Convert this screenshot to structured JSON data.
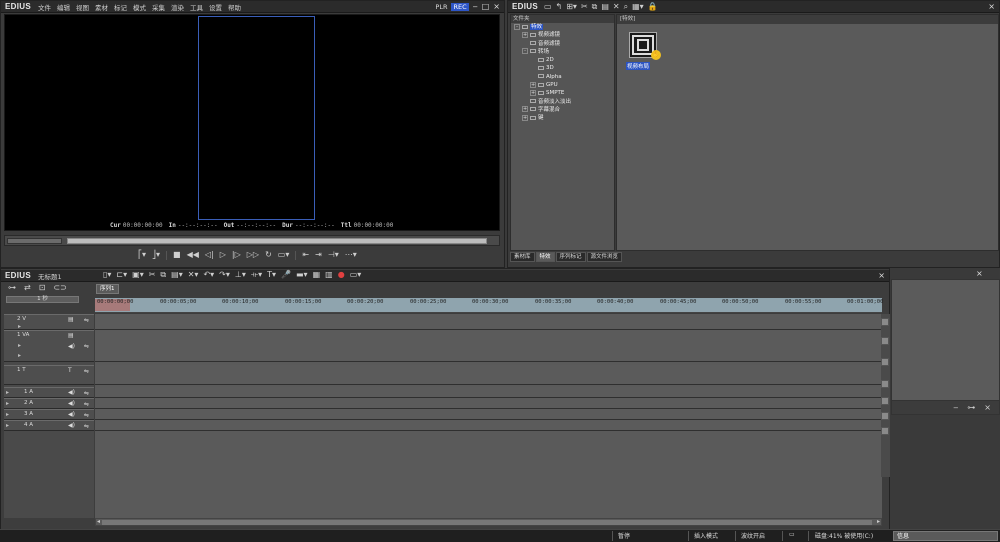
{
  "player": {
    "logo": "EDIUS",
    "menu": [
      "文件",
      "编辑",
      "视图",
      "素材",
      "标记",
      "模式",
      "采集",
      "渲染",
      "工具",
      "设置",
      "帮助"
    ],
    "plr_label": "PLR",
    "rec_label": "REC",
    "timecodes": [
      {
        "label": "Cur",
        "value": "00:00:00:00"
      },
      {
        "label": "In",
        "value": "--:--:--:--"
      },
      {
        "label": "Out",
        "value": "--:--:--:--"
      },
      {
        "label": "Dur",
        "value": "--:--:--:--"
      },
      {
        "label": "Ttl",
        "value": "00:00:00:00"
      }
    ]
  },
  "bin": {
    "logo": "EDIUS",
    "tree_header": "文件夹",
    "content_header": "[特效]",
    "tree": [
      {
        "label": "特效",
        "selected": true,
        "toggle": "-",
        "indent": 0
      },
      {
        "label": "视频滤镜",
        "toggle": "+",
        "indent": 1
      },
      {
        "label": "音频滤镜",
        "toggle": "",
        "indent": 1
      },
      {
        "label": "转场",
        "toggle": "-",
        "indent": 1
      },
      {
        "label": "2D",
        "toggle": "",
        "indent": 2
      },
      {
        "label": "3D",
        "toggle": "",
        "indent": 2
      },
      {
        "label": "Alpha",
        "toggle": "",
        "indent": 2
      },
      {
        "label": "GPU",
        "toggle": "+",
        "indent": 2
      },
      {
        "label": "SMPTE",
        "toggle": "+",
        "indent": 2
      },
      {
        "label": "音频淡入淡出",
        "toggle": "",
        "indent": 1
      },
      {
        "label": "字幕混合",
        "toggle": "+",
        "indent": 1
      },
      {
        "label": "键",
        "toggle": "+",
        "indent": 1
      }
    ],
    "clip_label": "视频布局",
    "tabs": [
      "素材库",
      "特效",
      "序列标记",
      "源文件浏览"
    ]
  },
  "timeline": {
    "logo": "EDIUS",
    "project": "无标题1",
    "sequence_tab": "序列1",
    "scale": "1 秒",
    "ruler": [
      "00:00:00;00",
      "00:00:05;00",
      "00:00:10;00",
      "00:00:15;00",
      "00:00:20;00",
      "00:00:25;00",
      "00:00:30;00",
      "00:00:35;00",
      "00:00:40;00",
      "00:00:45;00",
      "00:00:50;00",
      "00:00:55;00",
      "00:01:00;00"
    ],
    "tracks": [
      {
        "name": "2 V",
        "kind": "video"
      },
      {
        "name": "1 VA",
        "kind": "va"
      },
      {
        "name": "1 T",
        "kind": "title"
      },
      {
        "name": "1 A",
        "kind": "audio"
      },
      {
        "name": "2 A",
        "kind": "audio"
      },
      {
        "name": "3 A",
        "kind": "audio"
      },
      {
        "name": "4 A",
        "kind": "audio"
      }
    ]
  },
  "info_panel": {
    "tab": "信息"
  },
  "status": {
    "state": "暂停",
    "mode": "插入模式",
    "ripple": "波纹开启",
    "disk": "磁盘:41% 被使用(C:)"
  }
}
